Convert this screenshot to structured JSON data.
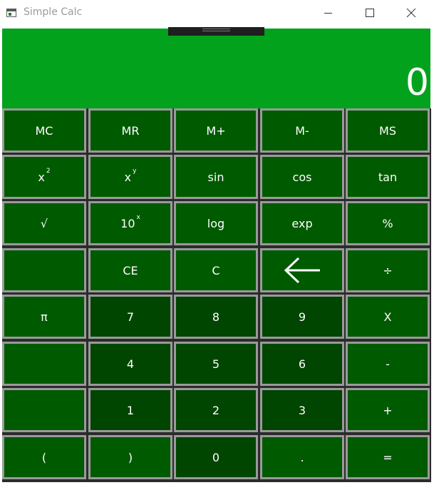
{
  "window": {
    "title": "Simple Calc"
  },
  "display": {
    "value": "0"
  },
  "colors": {
    "display_bg": "#02a21c",
    "key_bg": "#005a00",
    "number_key_bg": "#004500",
    "key_border": "#9a9a9a"
  },
  "keys": {
    "mc": "MC",
    "mr": "MR",
    "m_plus": "M+",
    "m_minus": "M-",
    "ms": "MS",
    "x_squared_base": "x",
    "x_squared_exp": "2",
    "x_power_base": "x",
    "x_power_exp": "y",
    "sin": "sin",
    "cos": "cos",
    "tan": "tan",
    "sqrt": "√",
    "ten_power_base": "10",
    "ten_power_exp": "x",
    "log": "log",
    "exp": "exp",
    "percent": "%",
    "ce": "CE",
    "c": "C",
    "backspace_icon": "back-arrow-icon",
    "divide": "÷",
    "pi": "π",
    "seven": "7",
    "eight": "8",
    "nine": "9",
    "multiply": "X",
    "four": "4",
    "five": "5",
    "six": "6",
    "minus": "-",
    "one": "1",
    "two": "2",
    "three": "3",
    "plus": "+",
    "open_paren": "(",
    "close_paren": ")",
    "zero": "0",
    "decimal": ".",
    "equals": "="
  }
}
